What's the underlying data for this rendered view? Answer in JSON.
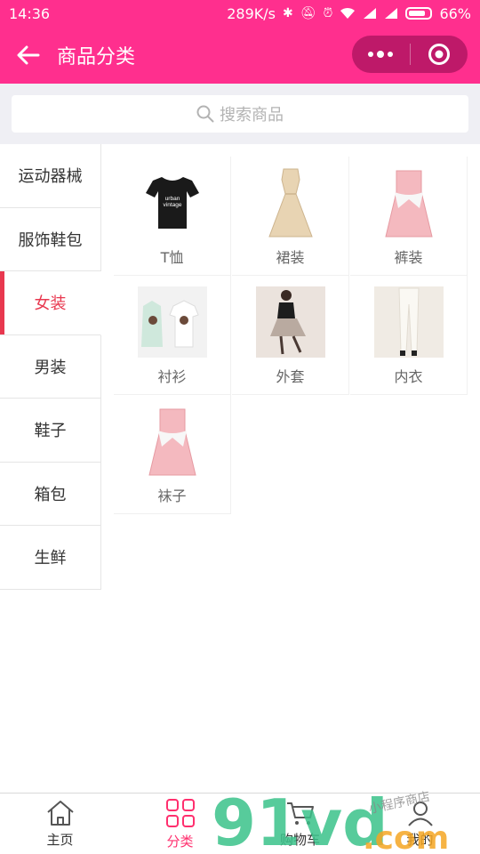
{
  "status_bar": {
    "time": "14:36",
    "network_speed": "289K/s",
    "battery": "66%"
  },
  "header": {
    "title": "商品分类",
    "back_icon": "arrow-left-icon",
    "more_icon": "more-dots-icon",
    "close_icon": "target-circle-icon",
    "background": "#ff2f8e"
  },
  "search": {
    "placeholder": "搜索商品",
    "icon": "search-icon"
  },
  "categories": {
    "active_index": 2,
    "accent": "#e8384f",
    "items": [
      {
        "label": "运动器械"
      },
      {
        "label": "服饰鞋包"
      },
      {
        "label": "女装"
      },
      {
        "label": "男装"
      },
      {
        "label": "鞋子"
      },
      {
        "label": "箱包"
      },
      {
        "label": "生鲜"
      }
    ]
  },
  "products": [
    {
      "label": "T恤",
      "image": "black-tshirt"
    },
    {
      "label": "裙装",
      "image": "beige-dress"
    },
    {
      "label": "裤装",
      "image": "pink-dress"
    },
    {
      "label": "衬衫",
      "image": "two-white-tees"
    },
    {
      "label": "外套",
      "image": "woman-skirt-photo"
    },
    {
      "label": "内衣",
      "image": "white-pants"
    },
    {
      "label": "袜子",
      "image": "pink-dress"
    }
  ],
  "tab_bar": {
    "active_index": 1,
    "accent": "#ff2f6e",
    "tabs": [
      {
        "label": "主页",
        "icon": "home-icon"
      },
      {
        "label": "分类",
        "icon": "grid-icon"
      },
      {
        "label": "购物车",
        "icon": "cart-icon"
      },
      {
        "label": "我的",
        "icon": "user-icon"
      }
    ]
  },
  "watermark": {
    "text": "91vd",
    "suffix": ".com",
    "tagline": "小程序商店"
  }
}
